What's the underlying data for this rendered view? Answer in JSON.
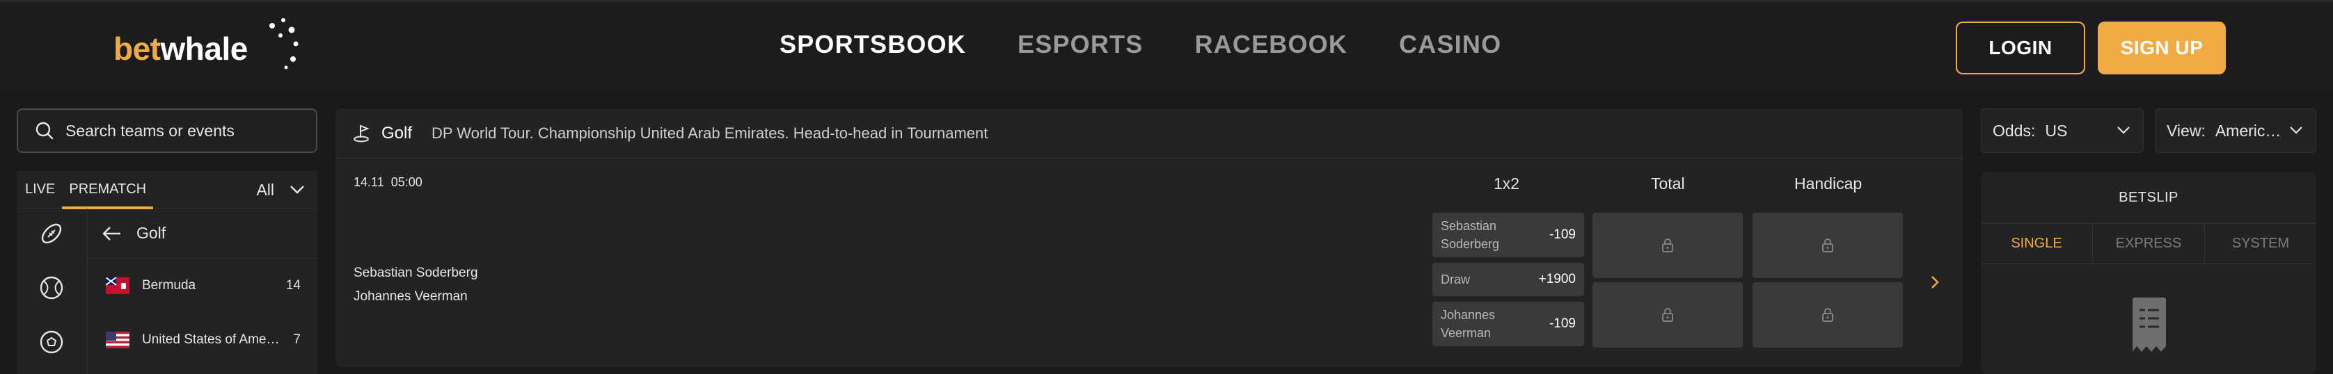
{
  "header": {
    "logo": {
      "part1": "bet",
      "part2": "whale"
    },
    "nav": [
      {
        "label": "SPORTSBOOK",
        "active": true
      },
      {
        "label": "ESPORTS",
        "active": false
      },
      {
        "label": "RACEBOOK",
        "active": false
      },
      {
        "label": "CASINO",
        "active": false
      }
    ],
    "login_label": "LOGIN",
    "signup_label": "SIGN UP"
  },
  "sidebar": {
    "search_placeholder": "Search teams or events",
    "tab_live": "LIVE",
    "tab_prematch": "PREMATCH",
    "filter_value": "All",
    "back_label": "Golf",
    "countries": [
      {
        "name": "Bermuda",
        "count": "14"
      },
      {
        "name": "United States of America",
        "count": "7"
      }
    ]
  },
  "event": {
    "sport": "Golf",
    "tournament": "DP World Tour. Championship United Arab Emirates. Head-to-head in Tournament",
    "date": "14.11",
    "time": "05:00",
    "markets": {
      "m1": "1x2",
      "m2": "Total",
      "m3": "Handicap"
    },
    "team1": "Sebastian Soderberg",
    "team2": "Johannes Veerman",
    "odds": [
      {
        "name_line1": "Sebastian",
        "name_line2": "Soderberg",
        "value": "-109"
      },
      {
        "name_line1": "Draw",
        "name_line2": "",
        "value": "+1900"
      },
      {
        "name_line1": "Johannes",
        "name_line2": "Veerman",
        "value": "-109"
      }
    ]
  },
  "settings": {
    "odds_label": "Odds:",
    "odds_value": "US",
    "view_label": "View:",
    "view_value": "Americ…"
  },
  "betslip": {
    "title": "BETSLIP",
    "tabs": [
      "SINGLE",
      "EXPRESS",
      "SYSTEM"
    ]
  },
  "colors": {
    "accent": "#f0ab45",
    "background": "#1a1a1b",
    "panel": "#232324",
    "odd_box": "#3a3a3c"
  }
}
